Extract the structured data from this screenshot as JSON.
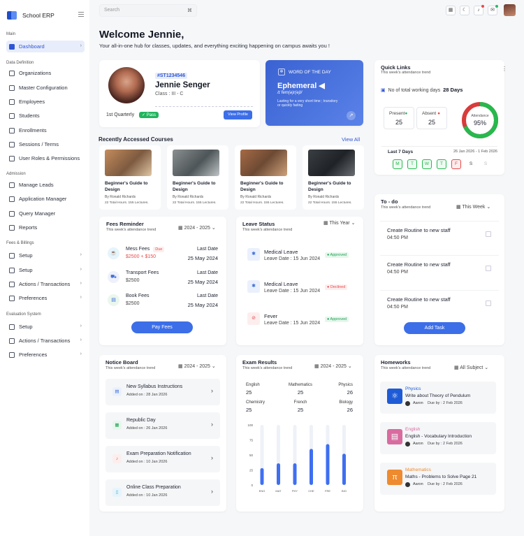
{
  "brand": {
    "name": "School ERP"
  },
  "sidebar": {
    "sections": [
      "Main",
      "Data Definition",
      "Admission",
      "Fees & Billings",
      "Evaluation System"
    ],
    "items": [
      {
        "label": "Dashboard"
      },
      {
        "label": "Organizations"
      },
      {
        "label": "Master Configuration"
      },
      {
        "label": "Employees"
      },
      {
        "label": "Students"
      },
      {
        "label": "Enrollments"
      },
      {
        "label": "Sessions / Terms"
      },
      {
        "label": "User Roles & Permissions"
      },
      {
        "label": "Manage Leads"
      },
      {
        "label": "Application Manager"
      },
      {
        "label": "Query Manager"
      },
      {
        "label": "Reports"
      },
      {
        "label": "Setup"
      },
      {
        "label": "Setup"
      },
      {
        "label": "Actions / Transactions"
      },
      {
        "label": "Preferences"
      },
      {
        "label": "Setup"
      },
      {
        "label": "Actions / Transactions"
      },
      {
        "label": "Preferences"
      }
    ]
  },
  "topbar": {
    "search_placeholder": "Search",
    "search_shortcut": "⌘"
  },
  "welcome": {
    "title": "Welcome Jennie,",
    "subtitle": "Your all-in-one hub for classes, updates, and everything exciting happening on campus awaits you !"
  },
  "profile": {
    "id": "#ST1234546",
    "name": "Jennie Senger",
    "class": "Class : III - C",
    "quarter": "1st Quarterly",
    "status": "Pass",
    "button": "View Profile"
  },
  "word": {
    "header": "WORD OF THE DAY",
    "word": "Ephemeral",
    "phonetic": "/ɪˈfem(ə)r(ə)l/",
    "meaning": "Lasting for a very short time ; transitory or quickly fading"
  },
  "quick": {
    "title": "Quick Links",
    "sub": "This week's attendance trend",
    "working_label": "No of total working days",
    "working_days": "28 Days",
    "present_label": "Present",
    "present": "25",
    "absent_label": "Absent",
    "absent": "25",
    "attendance_label": "Attendance",
    "attendance": "95%",
    "attendance_fraction": 0.95,
    "last7": "Last 7 Days",
    "range": "26 Jan 2026 - 1 Feb 2026",
    "days": [
      "M",
      "T",
      "W",
      "T",
      "F",
      "S",
      "S"
    ]
  },
  "courses": {
    "title": "Recently Accessed Courses",
    "view_all": "View All",
    "items": [
      {
        "title": "Beginner's Guide to Design",
        "author": "By Ronald Richards",
        "meta": "22 Total Hours. 155 Lectures."
      },
      {
        "title": "Beginner's Guide to Design",
        "author": "By Ronald Richards",
        "meta": "22 Total Hours. 155 Lectures."
      },
      {
        "title": "Beginner's Guide to Design",
        "author": "By Ronald Richards",
        "meta": "22 Total Hours. 155 Lectures."
      },
      {
        "title": "Beginner's Guide to Design",
        "author": "By Ronald Richards",
        "meta": "22 Total Hours. 155 Lectures."
      }
    ]
  },
  "fees": {
    "title": "Fees Reminder",
    "sub": "This week's attendance trend",
    "period": "2024 - 2025",
    "button": "Pay Fees",
    "items": [
      {
        "name": "Mess Fees",
        "badge": "Due",
        "amount": "$2500 + $150",
        "date_label": "Last Date",
        "date": "25 May 2024"
      },
      {
        "name": "Transport  Fees",
        "amount": "$2500",
        "date_label": "Last Date",
        "date": "25 May 2024"
      },
      {
        "name": "Book Fees",
        "amount": "$2500",
        "date_label": "Last Date",
        "date": "25 May 2024"
      }
    ]
  },
  "leave": {
    "title": "Leave Status",
    "sub": "This week's attendance trend",
    "period": "This Year",
    "items": [
      {
        "type": "Medical Leave",
        "date": "Leave Date : 15 Jun 2024",
        "status": "Approved"
      },
      {
        "type": "Medical Leave",
        "date": "Leave Date : 15 Jun 2024",
        "status": "Declined"
      },
      {
        "type": "Fever",
        "date": "Leave Date : 15 Jun 2024",
        "status": "Approved"
      }
    ]
  },
  "todo": {
    "title": "To - do",
    "sub": "This week's attendance trend",
    "period": "This Week",
    "button": "Add Task",
    "items": [
      {
        "task": "Create Routine to new staff",
        "time": "04:50 PM"
      },
      {
        "task": "Create Routine to new staff",
        "time": "04:50 PM"
      },
      {
        "task": "Create Routine to new staff",
        "time": "04:50 PM"
      }
    ]
  },
  "notice": {
    "title": "Notice Board",
    "sub": "This week's attendance trend",
    "period": "2024 - 2025",
    "items": [
      {
        "title": "New Syllabus Instructions",
        "date": "Added on : 28 Jan 2026"
      },
      {
        "title": "Republic Day",
        "date": "Added on : 26 Jan 2026"
      },
      {
        "title": "Exam Preparation Notification",
        "date": "Added on : 10 Jan 2026"
      },
      {
        "title": "Online Class Preparation",
        "date": "Added on : 10 Jan 2026"
      }
    ]
  },
  "exam": {
    "title": "Exam Results",
    "sub": "This week's attendance trend",
    "period": "2024 - 2025",
    "subjects": [
      {
        "name": "English",
        "score": "25"
      },
      {
        "name": "Mathematics",
        "score": "25"
      },
      {
        "name": "Physics",
        "score": "26"
      },
      {
        "name": "Chemistry",
        "score": "25"
      },
      {
        "name": "French",
        "score": "25"
      },
      {
        "name": "Biology",
        "score": "26"
      }
    ]
  },
  "chart_data": {
    "type": "bar",
    "categories": [
      "ENG",
      "MAT",
      "PHY",
      "CHE",
      "FRE",
      "BIO"
    ],
    "values": [
      28,
      36,
      36,
      60,
      68,
      52
    ],
    "yticks": [
      "100",
      "75",
      "50",
      "25",
      "0"
    ],
    "ylim": [
      0,
      100
    ],
    "title": "",
    "xlabel": "",
    "ylabel": ""
  },
  "homework": {
    "title": "Homeworks",
    "sub": "This week's attendance trend",
    "period": "All Subject",
    "items": [
      {
        "subject": "Physics",
        "title": "Write about Theory of Pendulum",
        "teacher": "Aaron",
        "due": "Due by : 2 Feb 2026",
        "color": "#1e5bd6"
      },
      {
        "subject": "English",
        "title": "English - Vocabulary Introduction",
        "teacher": "Aaron",
        "due": "Due by : 2 Feb 2026",
        "color": "#d86ba0"
      },
      {
        "subject": "Mathematics",
        "title": "Maths - Problems to Solve Page 21",
        "teacher": "Aaron",
        "due": "Due by : 2 Feb 2026",
        "color": "#ee8a2f"
      }
    ]
  }
}
